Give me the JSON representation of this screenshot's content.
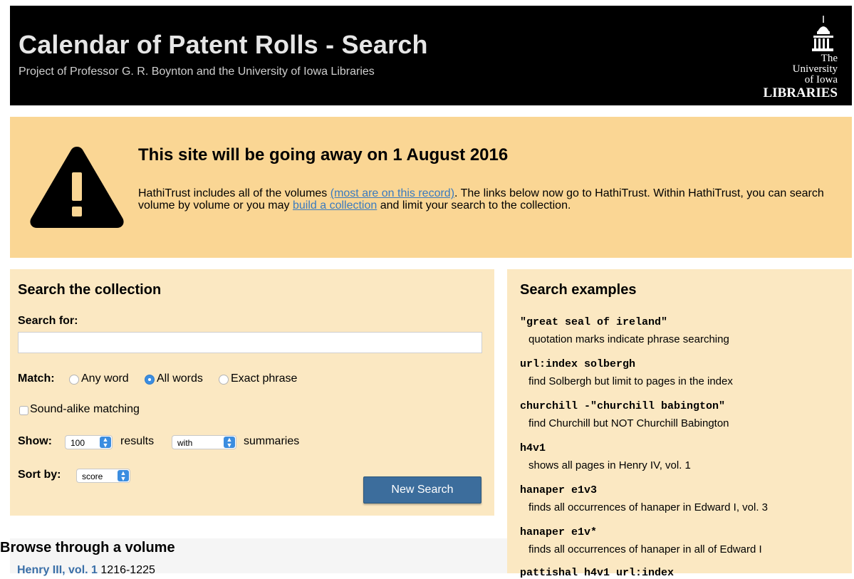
{
  "header": {
    "title": "Calendar of Patent Rolls - Search",
    "subtitle": "Project of Professor G. R. Boynton and the University of Iowa Libraries",
    "logo": {
      "line1": "The",
      "line2": "University",
      "line3": "of Iowa",
      "line4": "LIBRARIES"
    }
  },
  "alert": {
    "heading": "This site will be going away on 1 August 2016",
    "body_part1": "HathiTrust includes all of the volumes ",
    "link1": "(most are on this record)",
    "body_part2": ". The links below now go to HathiTrust. Within HathiTrust, you can search volume by volume or you may ",
    "link2": "build a collection",
    "body_part3": " and limit your search to the collection.",
    "icon": "warning-triangle-icon",
    "color": "#fad694"
  },
  "search": {
    "heading": "Search the collection",
    "search_for_label": "Search for:",
    "input_value": "",
    "match_label": "Match:",
    "match_options": [
      "Any word",
      "All words",
      "Exact phrase"
    ],
    "match_selected": "All words",
    "soundalike_label": "Sound-alike matching",
    "show_label": "Show:",
    "show_value": "100",
    "results_label": "results",
    "with_value": "with",
    "summaries_label": "summaries",
    "sortby_label": "Sort by:",
    "sortby_value": "score",
    "button_label": "New Search"
  },
  "browse": {
    "heading": "Browse through a volume",
    "first_volume": "Henry III, vol. 1",
    "first_range": " 1216-1225"
  },
  "examples": {
    "heading": "Search examples",
    "items": [
      {
        "query": "\"great seal of ireland\"",
        "desc": "quotation marks indicate phrase searching"
      },
      {
        "query": "url:index solbergh",
        "desc": "find Solbergh but limit to pages in the index"
      },
      {
        "query": "churchill -\"churchill babington\"",
        "desc": "find Churchill but NOT Churchill Babington"
      },
      {
        "query": "h4v1",
        "desc": "shows all pages in Henry IV, vol. 1"
      },
      {
        "query": "hanaper e1v3",
        "desc": "finds all occurrences of hanaper in Edward I, vol. 3"
      },
      {
        "query": "hanaper e1v*",
        "desc": "finds all occurrences of hanaper in all of Edward I"
      },
      {
        "query": "pattishal h4v1 url:index",
        "desc": ""
      }
    ]
  }
}
